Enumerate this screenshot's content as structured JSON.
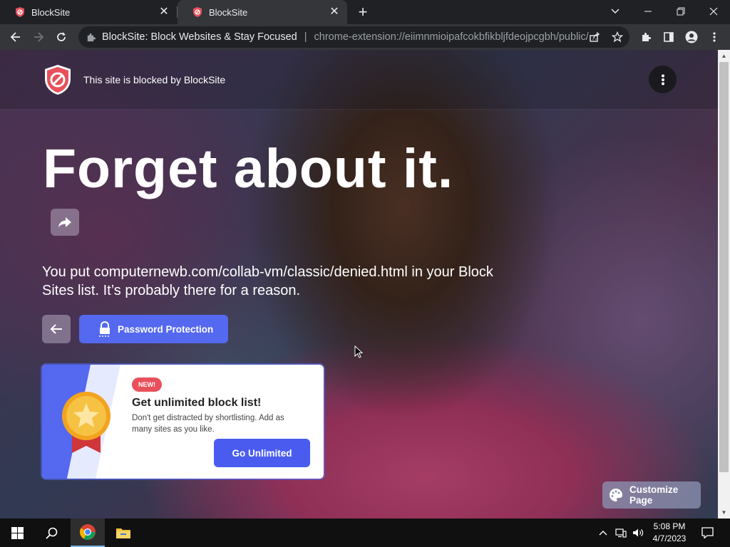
{
  "browser": {
    "tabs": [
      {
        "title": "BlockSite",
        "active": false
      },
      {
        "title": "BlockSite",
        "active": true
      }
    ],
    "new_tab_label": "+",
    "address_bar": {
      "page_title": "BlockSite: Block Websites & Stay Focused",
      "divider": "|",
      "url": "chrome-extension://eiimnmioipafcokbfikbljfdeojpcgbh/public/..."
    }
  },
  "page": {
    "header": {
      "blocked_text": "This site is blocked by BlockSite"
    },
    "headline": "Forget about it.",
    "reason_text": "You put computernewb.com/collab-vm/classic/denied.html in your Block Sites list. It’s probably there for a reason.",
    "password_button_label": "Password Protection",
    "promo": {
      "badge": "NEW!",
      "title": "Get unlimited block list!",
      "description": "Don't get distracted by shortlisting. Add as many sites as you like.",
      "button_label": "Go Unlimited"
    },
    "customize_label": "Customize Page"
  },
  "taskbar": {
    "time": "5:08 PM",
    "date": "4/7/2023"
  },
  "colors": {
    "accent_blue": "#5468f0",
    "badge_red": "#e8505b",
    "shield_red": "#e8505b",
    "chrome_dark": "#202124",
    "chrome_toolbar": "#35363a"
  }
}
